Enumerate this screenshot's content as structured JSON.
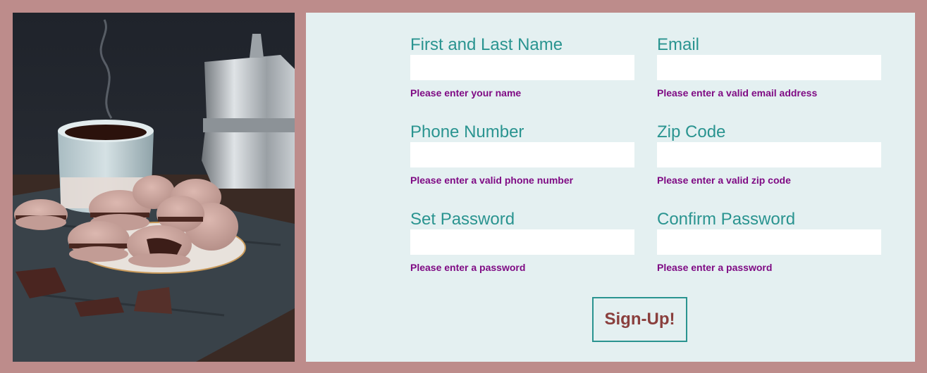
{
  "photo": {
    "description_icon": "coffee-macarons-photo"
  },
  "form": {
    "fields": [
      {
        "label": "First and Last Name",
        "value": "",
        "placeholder": "",
        "error": "Please enter your name"
      },
      {
        "label": "Email",
        "value": "",
        "placeholder": "",
        "error": "Please enter a valid email address"
      },
      {
        "label": "Phone Number",
        "value": "",
        "placeholder": "",
        "error": "Please enter a valid phone number"
      },
      {
        "label": "Zip Code",
        "value": "",
        "placeholder": "",
        "error": "Please enter a valid zip code"
      },
      {
        "label": "Set Password",
        "value": "",
        "placeholder": "",
        "error": "Please enter a password"
      },
      {
        "label": "Confirm Password",
        "value": "",
        "placeholder": "",
        "error": "Please enter a password"
      }
    ],
    "submit_label": "Sign-Up!"
  },
  "colors": {
    "page_background": "#bd8c8b",
    "panel_background": "#e4f0f1",
    "label_color": "#2a9490",
    "error_color": "#7f0b84",
    "button_text": "#8a3f3d",
    "button_border": "#2a9490"
  }
}
